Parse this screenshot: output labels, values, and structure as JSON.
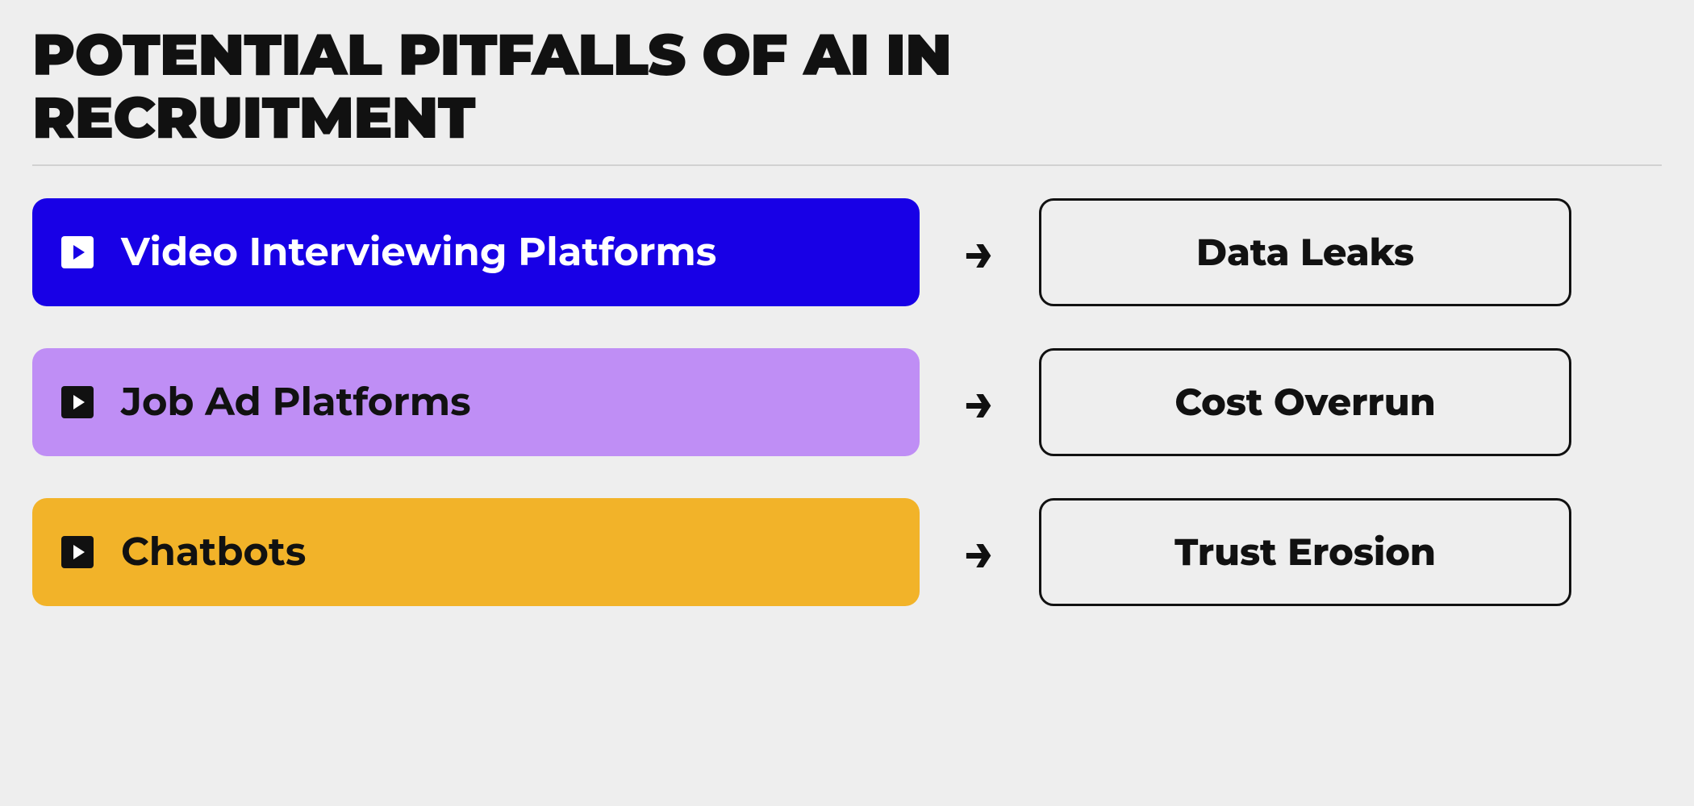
{
  "title": "POTENTIAL PITFALLS OF AI IN RECRUITMENT",
  "rows": [
    {
      "left": "Video Interviewing Platforms",
      "right": "Data Leaks",
      "color": "blue"
    },
    {
      "left": "Job Ad Platforms",
      "right": "Cost Overrun",
      "color": "purple"
    },
    {
      "left": "Chatbots",
      "right": "Trust Erosion",
      "color": "amber"
    }
  ],
  "arrow_glyph": "→"
}
